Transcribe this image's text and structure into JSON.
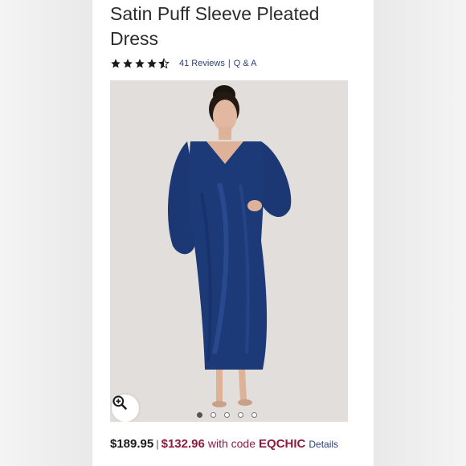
{
  "product": {
    "title": "Satin Puff Sleeve Pleated Dress",
    "rating": 4.5,
    "reviews_label": "41 Reviews",
    "separator": "|",
    "qa_label": "Q & A"
  },
  "gallery": {
    "image_alt": "Model wearing navy satin puff sleeve pleated dress",
    "slide_count": 5,
    "active_slide": 1,
    "zoom_icon": "zoom-in-icon"
  },
  "pricing": {
    "original_price": "$189.95",
    "separator": "|",
    "sale_price": "$132.96",
    "code_prefix": "with code",
    "promo_code": "EQCHIC",
    "details_label": "Details"
  },
  "colors": {
    "dress": "#1d3a78",
    "sale": "#8c1c3f",
    "link": "#2a3f7a",
    "stars": "#1a1a1a"
  }
}
